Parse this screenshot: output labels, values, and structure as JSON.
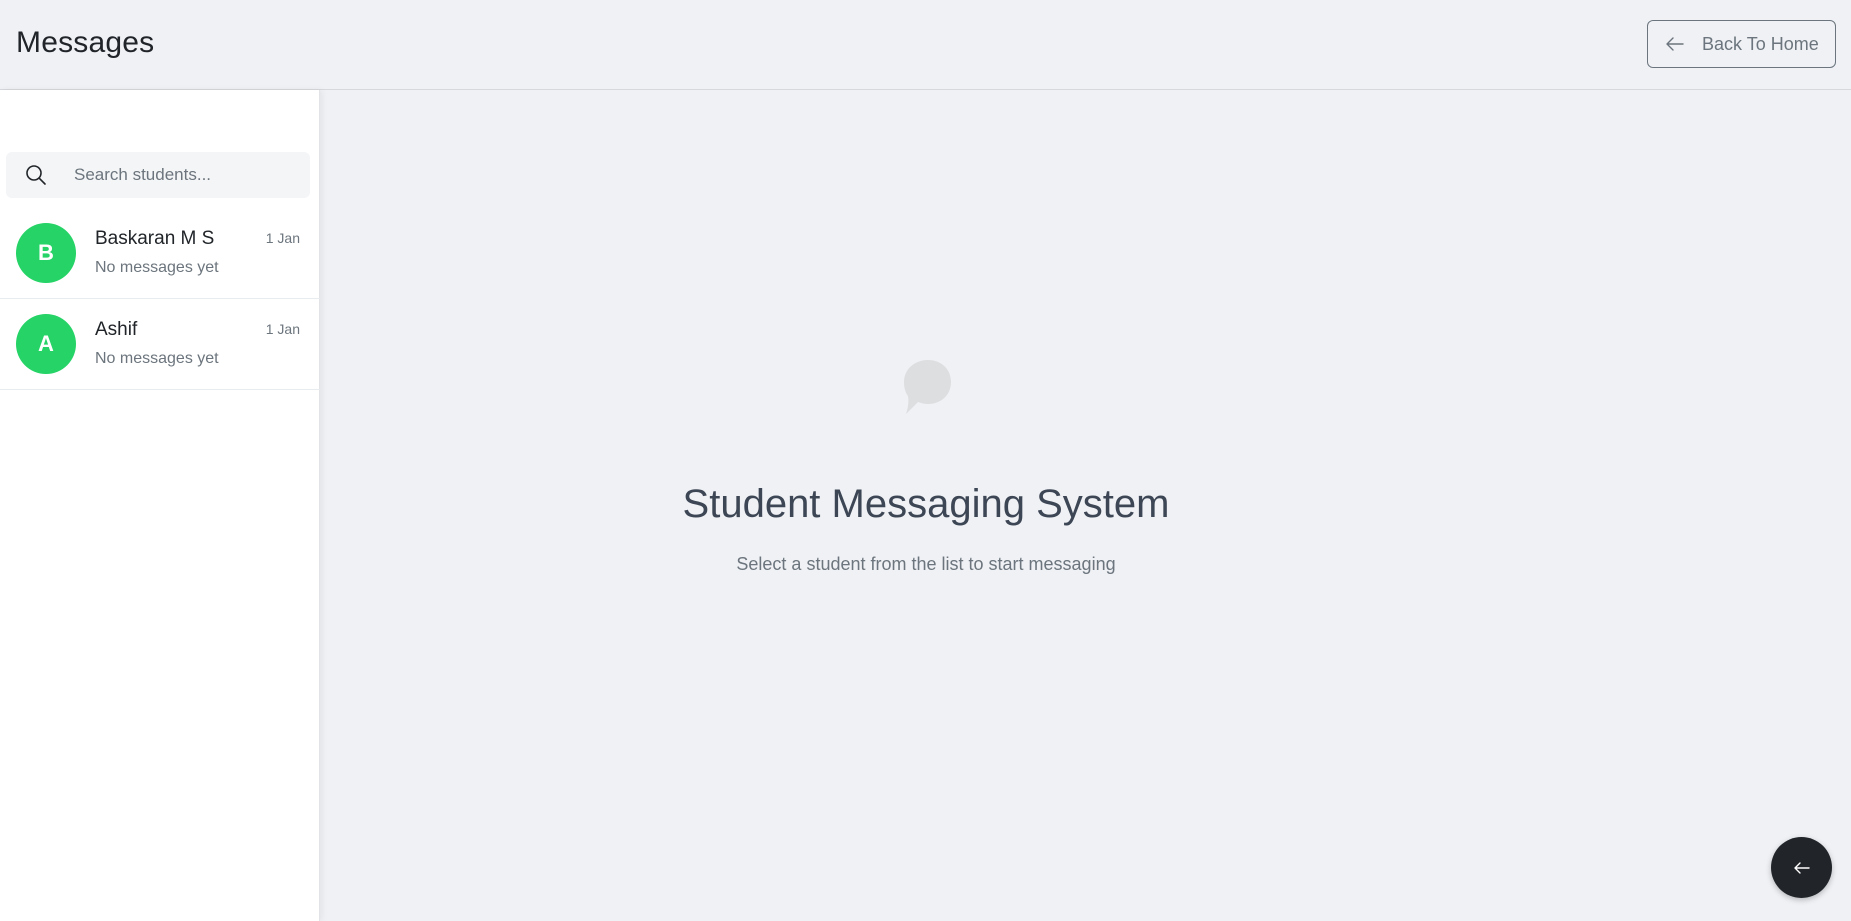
{
  "header": {
    "title": "Messages",
    "back_button_label": "Back To Home",
    "back_icon": "arrow-left-icon"
  },
  "sidebar": {
    "search": {
      "placeholder": "Search students...",
      "value": "",
      "icon": "search-icon"
    },
    "students": [
      {
        "initial": "B",
        "name": "Baskaran M S",
        "preview": "No messages yet",
        "date": "1 Jan"
      },
      {
        "initial": "A",
        "name": "Ashif",
        "preview": "No messages yet",
        "date": "1 Jan"
      }
    ]
  },
  "main": {
    "icon": "chat-bubble-icon",
    "title": "Student Messaging System",
    "subtitle": "Select a student from the list to start messaging"
  },
  "fab": {
    "icon": "arrow-left-icon"
  },
  "colors": {
    "avatar": "#25d366",
    "fab": "#212529",
    "background": "#eff1f5"
  }
}
